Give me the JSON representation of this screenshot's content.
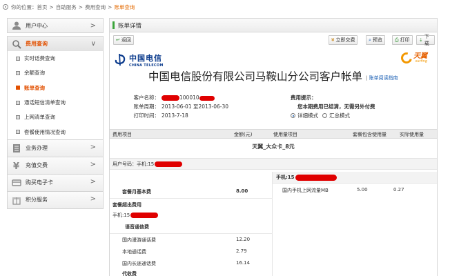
{
  "breadcrumb": {
    "prefix": "你的位置：",
    "items": [
      "首页",
      "自助服务",
      "费用查询"
    ],
    "current": "账单查询",
    "separator": ">"
  },
  "sidebar": {
    "user_center": "用户中心",
    "fee_query": "费用查询",
    "sub_items": [
      {
        "label": "实时话费查询",
        "active": false
      },
      {
        "label": "余额查询",
        "active": false
      },
      {
        "label": "账单查询",
        "active": true
      },
      {
        "label": "通话短信清单查询",
        "active": false
      },
      {
        "label": "上网清单查询",
        "active": false
      },
      {
        "label": "套餐使用情况查询",
        "active": false
      }
    ],
    "groups": [
      {
        "label": "业务办理",
        "icon": "doc-icon"
      },
      {
        "label": "充值交费",
        "icon": "yen-icon"
      },
      {
        "label": "购买电子卡",
        "icon": "card-icon"
      },
      {
        "label": "积分服务",
        "icon": "gift-icon"
      }
    ],
    "chevron_closed": ">",
    "chevron_open": "∨"
  },
  "main": {
    "title": "账单详情",
    "toolbar": {
      "back": "返回",
      "pay": "立即交费",
      "preview": "预览",
      "print": "打印",
      "download": "下载"
    },
    "logo_left": {
      "cn": "中国电信",
      "en": "CHINA TELECOM"
    },
    "logo_right": {
      "cn": "天翼",
      "en": "surfing"
    },
    "bill_title": "中国电信股份有限公司马鞍山分公司客户帐单",
    "bill_guide": "账单阅读指南",
    "info": {
      "customer_label": "客户名称：",
      "customer_value": "100010",
      "period_label": "账单周期：",
      "period_value": "2013-06-01 至2013-06-30",
      "print_label": "打印时间：",
      "print_value": "2013-7-18"
    },
    "tips": {
      "title": "费用提示：",
      "text": "您本期费用已结清，无需另外付费",
      "mode_detail": "详细模式",
      "mode_summary": "汇总模式"
    },
    "table_head": {
      "item": "费用项目",
      "amount": "金额(元)",
      "usage_item": "使用量项目",
      "pkg_usage": "套餐包含使用量",
      "actual_usage": "实际使用量"
    },
    "package_name": "天翼_大众卡_8元",
    "user_line": "用户号码：手机:15",
    "phone_prefix": "手机:15",
    "rows": {
      "monthly_fee_label": "套餐月基本费",
      "monthly_fee_value": "8.00",
      "overage_label": "套餐超出费用",
      "phone_label": "手机:15",
      "voice_label": "语音通信费",
      "roam_label": "国内漫游通话费",
      "roam_value": "12.20",
      "local_label": "本地通话费",
      "local_value": "2.79",
      "ld_label": "国内长途通话费",
      "ld_value": "16.14",
      "collect_label": "代收费"
    },
    "mobile_data": {
      "label": "国内手机上网流量MB",
      "included": "5.00",
      "actual": "0.27"
    }
  }
}
